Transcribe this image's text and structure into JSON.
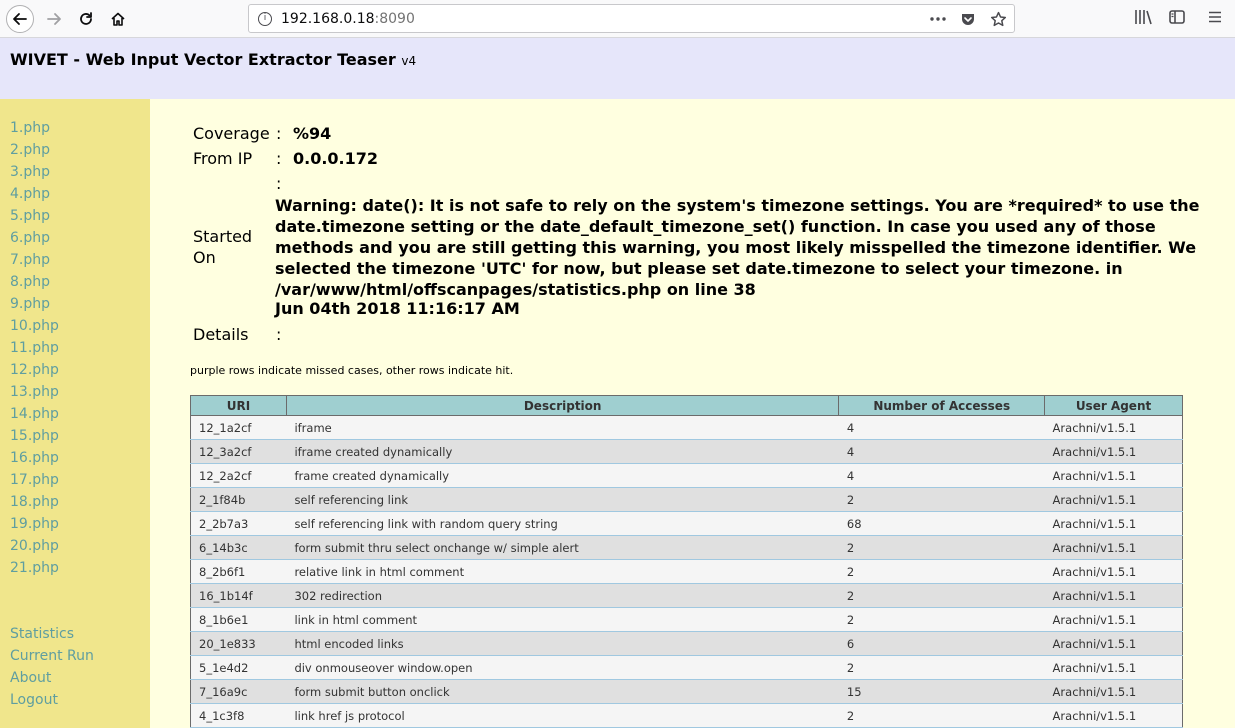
{
  "browser": {
    "url_host": "192.168.0.18",
    "url_port": ":8090",
    "page_actions_icon": "ellipsis-icon",
    "pocket_icon": "pocket-icon",
    "bookmark_icon": "star-icon"
  },
  "header": {
    "title": "WIVET - Web Input Vector Extractor Teaser",
    "version": "v4"
  },
  "nav": {
    "pages": [
      "1.php",
      "2.php",
      "3.php",
      "4.php",
      "5.php",
      "6.php",
      "7.php",
      "8.php",
      "9.php",
      "10.php",
      "11.php",
      "12.php",
      "13.php",
      "14.php",
      "15.php",
      "16.php",
      "17.php",
      "18.php",
      "19.php",
      "20.php",
      "21.php"
    ],
    "bottom": [
      "Statistics",
      "Current Run",
      "About",
      "Logout"
    ]
  },
  "stats": {
    "coverage_label": "Coverage",
    "coverage_value": "%94",
    "from_ip_label": "From IP",
    "from_ip_value": "0.0.0.172",
    "started_label_1": "Started",
    "started_label_2": "On",
    "warning": "Warning: date(): It is not safe to rely on the system's timezone settings. You are *required* to use the date.timezone setting or the date_default_timezone_set() function. In case you used any of those methods and you are still getting this warning, you most likely misspelled the timezone identifier. We selected the timezone 'UTC' for now, but please set date.timezone to select your timezone. in /var/www/html/offscanpages/statistics.php on line 38",
    "started_value": "Jun 04th 2018 11:16:17 AM",
    "details_label": "Details",
    "colon": ":"
  },
  "note": "purple rows indicate missed cases, other rows indicate hit.",
  "table": {
    "headers": [
      "URI",
      "Description",
      "Number of Accesses",
      "User Agent"
    ],
    "rows": [
      [
        "12_1a2cf",
        "iframe",
        "4",
        "Arachni/v1.5.1"
      ],
      [
        "12_3a2cf",
        "iframe created dynamically",
        "4",
        "Arachni/v1.5.1"
      ],
      [
        "12_2a2cf",
        "frame created dynamically",
        "4",
        "Arachni/v1.5.1"
      ],
      [
        "2_1f84b",
        "self referencing link",
        "2",
        "Arachni/v1.5.1"
      ],
      [
        "2_2b7a3",
        "self referencing link with random query string",
        "68",
        "Arachni/v1.5.1"
      ],
      [
        "6_14b3c",
        "form submit thru select onchange w/ simple alert",
        "2",
        "Arachni/v1.5.1"
      ],
      [
        "8_2b6f1",
        "relative link in html comment",
        "2",
        "Arachni/v1.5.1"
      ],
      [
        "16_1b14f",
        "302 redirection",
        "2",
        "Arachni/v1.5.1"
      ],
      [
        "8_1b6e1",
        "link in html comment",
        "2",
        "Arachni/v1.5.1"
      ],
      [
        "20_1e833",
        "html encoded links",
        "6",
        "Arachni/v1.5.1"
      ],
      [
        "5_1e4d2",
        "div onmouseover window.open",
        "2",
        "Arachni/v1.5.1"
      ],
      [
        "7_16a9c",
        "form submit button onclick",
        "15",
        "Arachni/v1.5.1"
      ],
      [
        "4_1c3f8",
        "link href js protocol",
        "2",
        "Arachni/v1.5.1"
      ]
    ]
  },
  "colors": {
    "header_bg": "#e6e6fa",
    "nav_bg": "#f0e68c",
    "main_bg": "#ffffe0",
    "link": "#5f9ea0",
    "table_header": "#9fcfd0"
  }
}
